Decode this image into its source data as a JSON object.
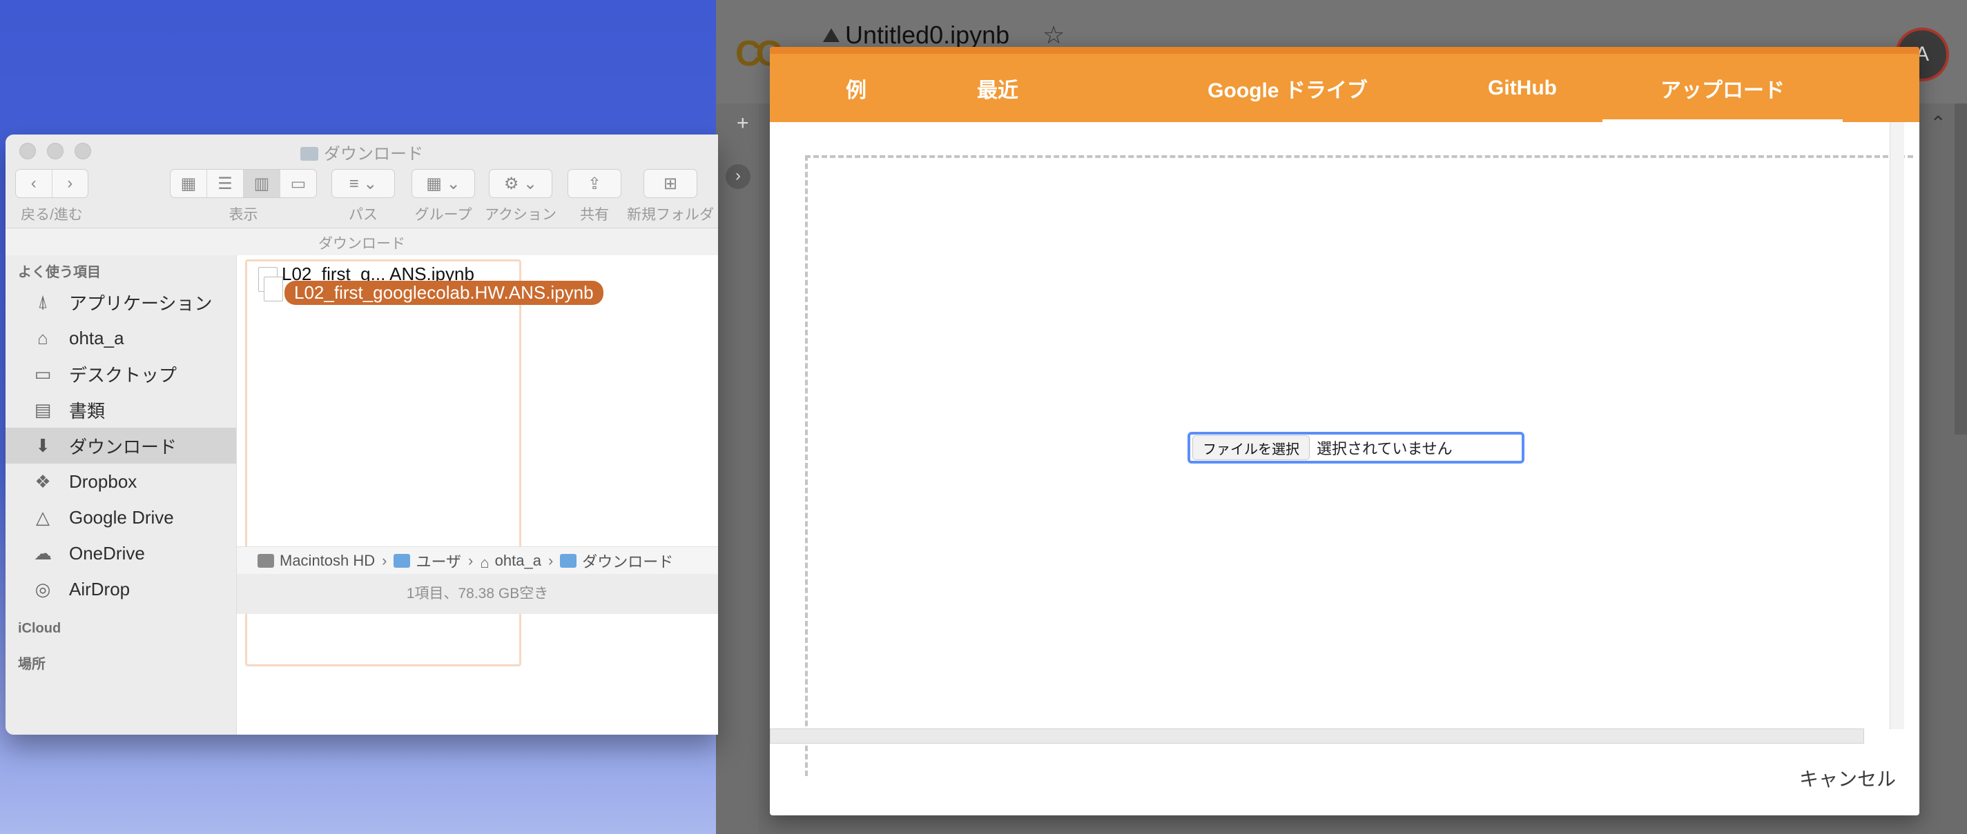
{
  "finder": {
    "title": "ダウンロード",
    "toolbar": {
      "back_forward_label": "戻る/進む",
      "view_label": "表示",
      "path_label": "パス",
      "group_label": "グループ",
      "action_label": "アクション",
      "share_label": "共有",
      "new_folder_label": "新規フォルダ"
    },
    "path_title": "ダウンロード",
    "sidebar": {
      "favorites_header": "よく使う項目",
      "items": [
        {
          "label": "アプリケーション",
          "icon": "applications-icon"
        },
        {
          "label": "ohta_a",
          "icon": "home-icon"
        },
        {
          "label": "デスクトップ",
          "icon": "desktop-icon"
        },
        {
          "label": "書類",
          "icon": "documents-icon"
        },
        {
          "label": "ダウンロード",
          "icon": "downloads-icon"
        },
        {
          "label": "Dropbox",
          "icon": "dropbox-icon"
        },
        {
          "label": "Google Drive",
          "icon": "google-drive-icon"
        },
        {
          "label": "OneDrive",
          "icon": "onedrive-icon"
        },
        {
          "label": "AirDrop",
          "icon": "airdrop-icon"
        }
      ],
      "icloud_header": "iCloud",
      "locations_header": "場所"
    },
    "files": {
      "ghost_name": "L02_first_g... ANS.ipynb",
      "dragging_name": "L02_first_googlecolab.HW.ANS.ipynb"
    },
    "breadcrumbs": [
      "Macintosh HD",
      "ユーザ",
      "ohta_a",
      "ダウンロード"
    ],
    "status": "1項目、78.38 GB空き"
  },
  "colab": {
    "notebook_title": "Untitled0.ipynb",
    "avatar_letter": "A",
    "dialog": {
      "tabs": [
        "例",
        "最近",
        "Google ドライブ",
        "GitHub",
        "アップロード"
      ],
      "active_tab": "アップロード",
      "choose_file_button": "ファイルを選択",
      "no_file_text": "選択されていません",
      "cancel_label": "キャンセル"
    },
    "colors": {
      "tab_bar": "#f19a37",
      "dialog_bg": "#ffffff",
      "focus_ring": "#5b8ff9"
    }
  }
}
